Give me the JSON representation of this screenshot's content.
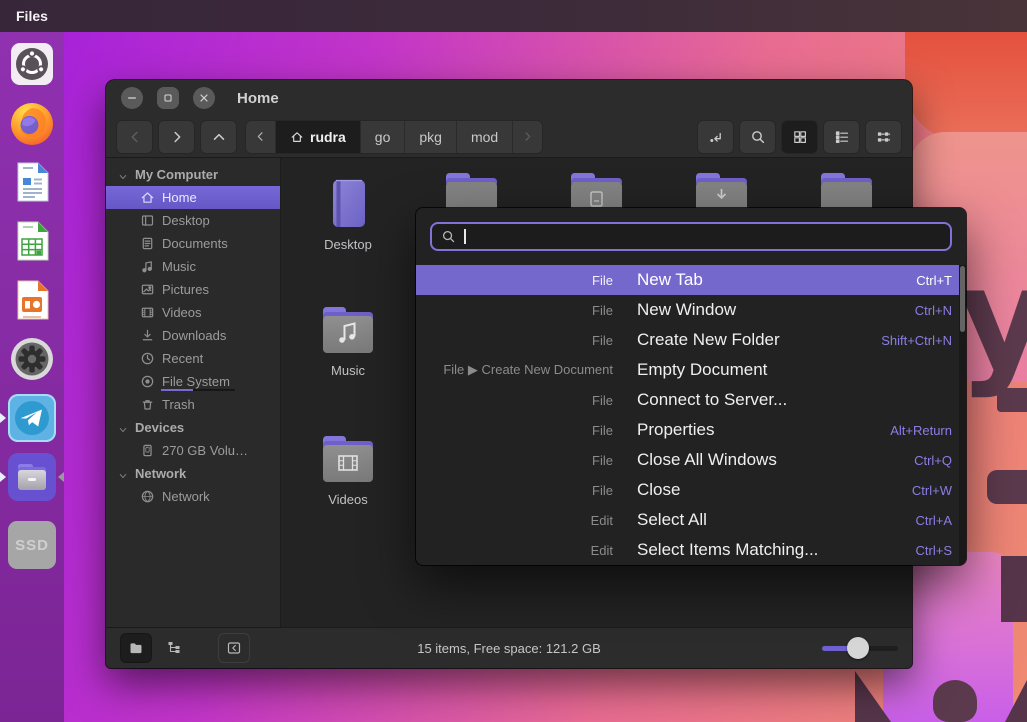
{
  "topbar": {
    "app_name": "Files"
  },
  "dock": {
    "items": [
      {
        "id": "ubuntu-software"
      },
      {
        "id": "firefox"
      },
      {
        "id": "libreoffice-writer"
      },
      {
        "id": "libreoffice-calc"
      },
      {
        "id": "libreoffice-impress"
      },
      {
        "id": "settings"
      },
      {
        "id": "telegram",
        "running": true,
        "focused": true
      },
      {
        "id": "files",
        "running": true,
        "active": true
      },
      {
        "id": "ssd",
        "text": "SSD"
      }
    ]
  },
  "window": {
    "titlebar": {
      "title": "Home",
      "controls": [
        "minimize",
        "maximize",
        "close"
      ]
    },
    "toolbar": {
      "nav_icons": [
        "back",
        "forward",
        "up"
      ],
      "breadcrumbs": [
        {
          "label": "rudra",
          "active": true
        },
        {
          "label": "go"
        },
        {
          "label": "pkg"
        },
        {
          "label": "mod"
        }
      ],
      "view_icons": [
        "location-entry",
        "search",
        "icon-view",
        "list-view",
        "compact-view"
      ],
      "active_view": "icon-view"
    },
    "sidebar": {
      "sections": [
        {
          "label": "My Computer",
          "items": [
            {
              "label": "Home",
              "icon": "home",
              "selected": true
            },
            {
              "label": "Desktop",
              "icon": "desktop"
            },
            {
              "label": "Documents",
              "icon": "document"
            },
            {
              "label": "Music",
              "icon": "music"
            },
            {
              "label": "Pictures",
              "icon": "picture"
            },
            {
              "label": "Videos",
              "icon": "video"
            },
            {
              "label": "Downloads",
              "icon": "download"
            },
            {
              "label": "Recent",
              "icon": "recent"
            },
            {
              "label": "File System",
              "icon": "disk",
              "usage_bar": true
            },
            {
              "label": "Trash",
              "icon": "trash"
            }
          ]
        },
        {
          "label": "Devices",
          "items": [
            {
              "label": "270 GB Volu…",
              "icon": "drive"
            }
          ]
        },
        {
          "label": "Network",
          "items": [
            {
              "label": "Network",
              "icon": "network"
            }
          ]
        }
      ]
    },
    "files_visible": [
      {
        "label": "Desktop",
        "icon": "desktop-special"
      },
      {
        "label": "Music",
        "icon": "folder-music"
      },
      {
        "label": "Videos",
        "icon": "folder-film"
      }
    ],
    "background_folders": [
      {
        "emblem": "none"
      },
      {
        "emblem": "document"
      },
      {
        "emblem": "download"
      },
      {
        "emblem": "none"
      }
    ],
    "statusbar": {
      "text": "15 items, Free space: 121.2 GB",
      "icons": [
        "places",
        "treeview",
        "hide-panel"
      ],
      "zoom_slider_fraction": 0.5
    }
  },
  "action_menu": {
    "search_value": "",
    "items": [
      {
        "context": "File",
        "label": "New Tab",
        "shortcut": "Ctrl+T",
        "highlighted": true
      },
      {
        "context": "File",
        "label": "New Window",
        "shortcut": "Ctrl+N"
      },
      {
        "context": "File",
        "label": "Create New Folder",
        "shortcut": "Shift+Ctrl+N"
      },
      {
        "context": "File ▶ Create New Document",
        "label": "Empty Document",
        "shortcut": ""
      },
      {
        "context": "File",
        "label": "Connect to Server...",
        "shortcut": ""
      },
      {
        "context": "File",
        "label": "Properties",
        "shortcut": "Alt+Return"
      },
      {
        "context": "File",
        "label": "Close All Windows",
        "shortcut": "Ctrl+Q"
      },
      {
        "context": "File",
        "label": "Close",
        "shortcut": "Ctrl+W"
      },
      {
        "context": "Edit",
        "label": "Select All",
        "shortcut": "Ctrl+A"
      },
      {
        "context": "Edit",
        "label": "Select Items Matching...",
        "shortcut": "Ctrl+S"
      }
    ]
  },
  "colors": {
    "accent": "#7568cd",
    "menu_highlight": "#7568cd",
    "shortcut_text": "#8b7ee2",
    "sidebar_selected": "#7063d2",
    "dock_background": "#8a2da4"
  }
}
